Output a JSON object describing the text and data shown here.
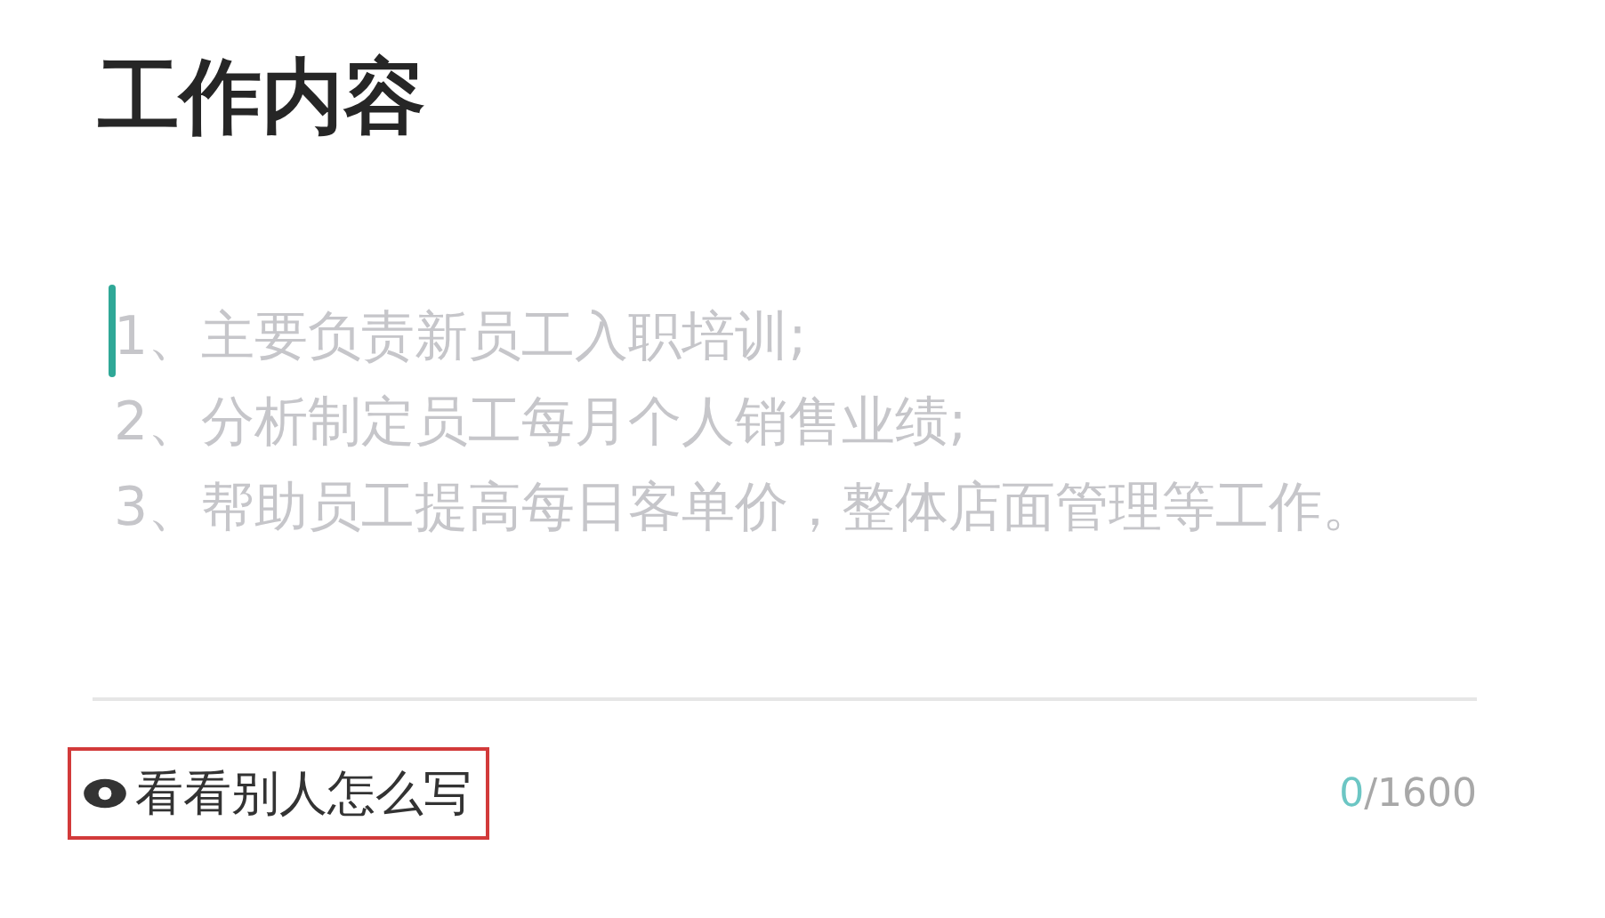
{
  "title": "工作内容",
  "editor": {
    "placeholder": "1、主要负责新员工入职培训;\n2、分析制定员工每月个人销售业绩;\n3、帮助员工提高每日客单价，整体店面管理等工作。",
    "focused": true
  },
  "example_link": {
    "label": "看看别人怎么写",
    "highlighted": true
  },
  "counter": {
    "count": "0",
    "limit": "/1600"
  }
}
